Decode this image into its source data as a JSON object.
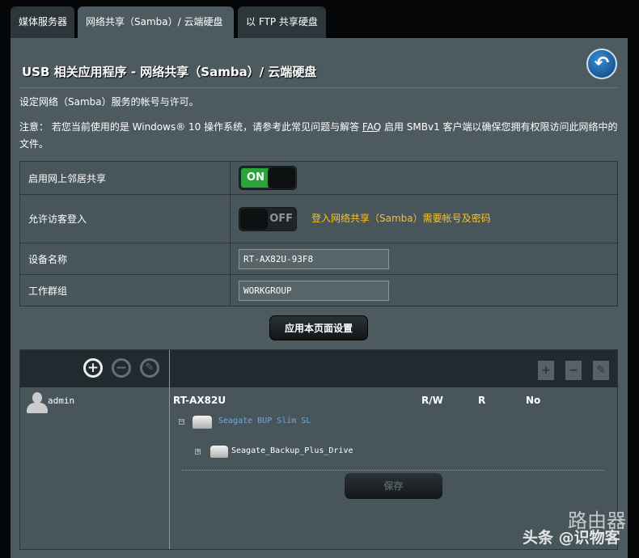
{
  "tabs": [
    {
      "label": "媒体服务器"
    },
    {
      "label": "网络共享（Samba）/ 云端硬盘"
    },
    {
      "label": "以 FTP 共享硬盘"
    }
  ],
  "page_title": "USB 相关应用程序 - 网络共享（Samba）/ 云端硬盘",
  "description": "设定网络（Samba）服务的帐号与许可。",
  "notice": {
    "before": "注意： 若您当前使用的是 Windows® 10 操作系统，请参考此常见问题与解答 ",
    "link": "FAQ",
    "after": " 启用 SMBv1 客户端以确保您拥有权限访问此网络中的文件。"
  },
  "settings": {
    "network_place": {
      "label": "启用网上邻居共享",
      "toggle": "ON"
    },
    "guest_login": {
      "label": "允许访客登入",
      "toggle": "OFF",
      "note": "登入网络共享（Samba）需要帐号及密码"
    },
    "device_name": {
      "label": "设备名称",
      "value": "RT-AX82U-93F8"
    },
    "workgroup": {
      "label": "工作群组",
      "value": "WORKGROUP"
    }
  },
  "apply_label": "应用本页面设置",
  "share": {
    "users": [
      {
        "name": "admin"
      }
    ],
    "device": "RT-AX82U",
    "columns": [
      "R/W",
      "R",
      "No"
    ],
    "disk": "Seagate BUP Slim SL",
    "folder": "Seagate_Backup_Plus_Drive",
    "save_label": "保存"
  },
  "watermark": {
    "line1": "路由器",
    "line2": "头条 @识物客"
  }
}
